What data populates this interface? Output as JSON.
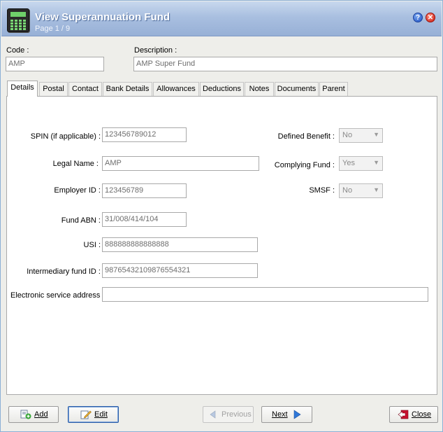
{
  "window": {
    "title": "View Superannuation Fund",
    "subtitle": "Page 1 / 9",
    "help_glyph": "?",
    "close_glyph": "✕"
  },
  "header": {
    "code_label": "Code :",
    "code_value": "AMP",
    "description_label": "Description :",
    "description_value": "AMP Super Fund"
  },
  "tabs": [
    {
      "label": "Details"
    },
    {
      "label": "Postal"
    },
    {
      "label": "Contact"
    },
    {
      "label": "Bank Details"
    },
    {
      "label": "Allowances"
    },
    {
      "label": "Deductions"
    },
    {
      "label": "Notes"
    },
    {
      "label": "Documents"
    },
    {
      "label": "Parent"
    }
  ],
  "details": {
    "spin_label": "SPIN (if applicable) :",
    "spin_value": "123456789012",
    "legal_name_label": "Legal Name :",
    "legal_name_value": "AMP",
    "employer_id_label": "Employer ID :",
    "employer_id_value": "123456789",
    "fund_abn_label": "Fund ABN :",
    "fund_abn_value": "31/008/414/104",
    "usi_label": "USI :",
    "usi_value": "888888888888888",
    "intermediary_label": "Intermediary fund ID :",
    "intermediary_value": "98765432109876554321",
    "esa_label": "Electronic service address :",
    "esa_value": "",
    "defined_benefit_label": "Defined Benefit :",
    "defined_benefit_value": "No",
    "complying_fund_label": "Complying Fund :",
    "complying_fund_value": "Yes",
    "smsf_label": "SMSF :",
    "smsf_value": "No",
    "dropdown_arrow": "▼"
  },
  "buttons": {
    "add": "Add",
    "edit": "Edit",
    "previous": "Previous",
    "next": "Next",
    "close": "Close"
  },
  "icons": {
    "app": "calculator-icon",
    "add": "add-document-icon",
    "edit": "edit-pencil-icon",
    "previous": "arrow-left-icon",
    "next": "arrow-right-icon",
    "close": "close-exit-icon"
  },
  "colors": {
    "titlebar": "#a9bfe0",
    "focus_border": "#2d5ea8",
    "next_arrow": "#2f78d8",
    "close_icon": "#c8102e"
  }
}
